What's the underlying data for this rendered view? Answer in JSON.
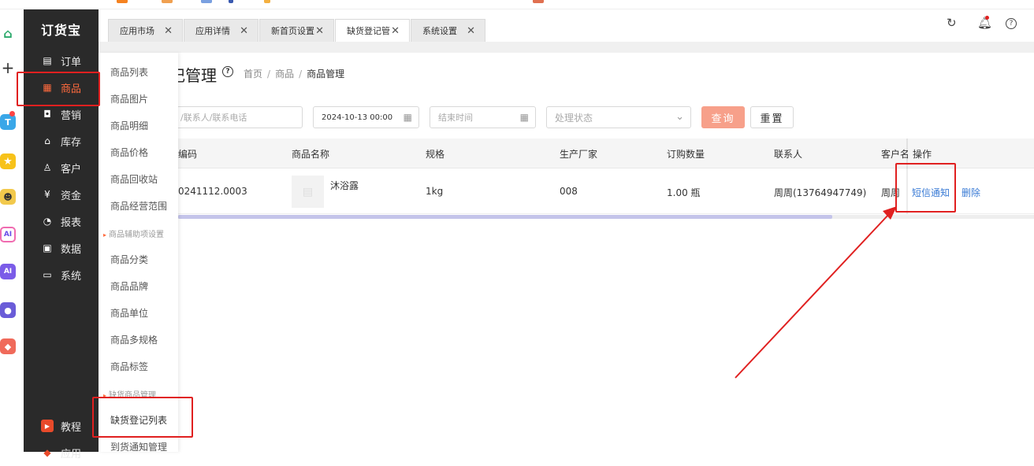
{
  "app": {
    "logo": "订货宝"
  },
  "sidebar": {
    "items": [
      {
        "label": "订单",
        "icon": "order-icon"
      },
      {
        "label": "商品",
        "icon": "grid-icon",
        "active": true
      },
      {
        "label": "营销",
        "icon": "marketing-icon"
      },
      {
        "label": "库存",
        "icon": "warehouse-icon"
      },
      {
        "label": "客户",
        "icon": "user-icon"
      },
      {
        "label": "资金",
        "icon": "money-bag-icon"
      },
      {
        "label": "报表",
        "icon": "pie-chart-icon"
      },
      {
        "label": "数据",
        "icon": "data-icon"
      },
      {
        "label": "系统",
        "icon": "monitor-icon"
      }
    ],
    "bottom": [
      {
        "label": "教程",
        "icon": "video-icon"
      },
      {
        "label": "应用",
        "icon": "app-icon"
      }
    ]
  },
  "submenu": {
    "items": [
      "商品列表",
      "商品图片",
      "商品明细",
      "商品价格",
      "商品回收站",
      "商品经营范围"
    ],
    "group1": "商品辅助项设置",
    "items2": [
      "商品分类",
      "商品品牌",
      "商品单位",
      "商品多规格",
      "商品标签"
    ],
    "group2": "缺货商品管理",
    "items3": [
      "缺货登记列表",
      "到货通知管理"
    ]
  },
  "tabs": [
    {
      "label": "应用市场"
    },
    {
      "label": "应用详情"
    },
    {
      "label": "新首页设置"
    },
    {
      "label": "缺货登记管",
      "active": true
    },
    {
      "label": "系统设置"
    }
  ],
  "page": {
    "title": "记管理",
    "breadcrumb": [
      "首页",
      "商品",
      "商品管理"
    ]
  },
  "filters": {
    "contact_placeholder": "/联系人/联系电话",
    "start_time": "2024-10-13 00:00",
    "end_placeholder": "结束时间",
    "status_placeholder": "处理状态",
    "query_label": "查询",
    "reset_label": "重置"
  },
  "table": {
    "headers": [
      "编码",
      "商品名称",
      "规格",
      "生产厂家",
      "订购数量",
      "联系人",
      "客户名",
      "操作"
    ],
    "rows": [
      {
        "code": "0241112.0003",
        "name": "沐浴露",
        "spec": "1kg",
        "manufacturer": "008",
        "quantity": "1.00 瓶",
        "contact": "周周(13764947749)",
        "customer": "周周",
        "action_notify": "短信通知",
        "action_delete": "删除"
      }
    ]
  },
  "colors": {
    "accent": "#ff6a3d",
    "sidebar_bg": "#2a2a2a",
    "link": "#3a7bd5",
    "highlight": "#e02020"
  }
}
